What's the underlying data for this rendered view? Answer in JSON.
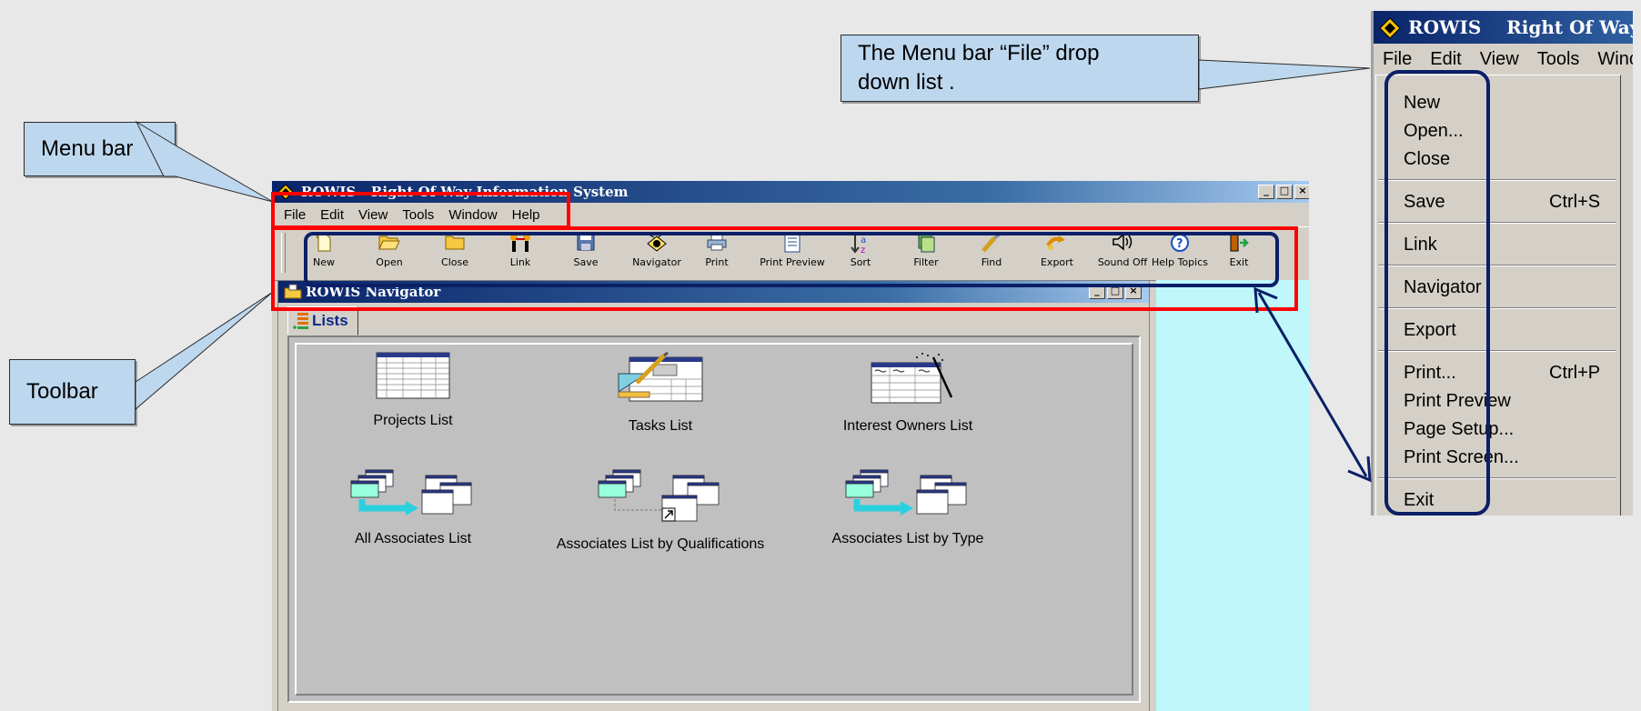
{
  "callouts": {
    "menu_bar": "Menu bar",
    "toolbar": "Toolbar",
    "file_dropdown": "The Menu bar “File” drop down list ."
  },
  "app": {
    "title": "ROWIS - Right Of Way Information System",
    "menu": [
      "File",
      "Edit",
      "View",
      "Tools",
      "Window",
      "Help"
    ],
    "window_buttons": [
      "_",
      "□",
      "×"
    ],
    "toolbar": [
      {
        "label": "New",
        "icon": "new-icon"
      },
      {
        "label": "Open",
        "icon": "open-folder-icon"
      },
      {
        "label": "Close",
        "icon": "close-folder-icon"
      },
      {
        "label": "Link",
        "icon": "link-icon"
      },
      {
        "label": "Save",
        "icon": "save-icon"
      },
      {
        "label": "Navigator",
        "icon": "navigator-icon"
      },
      {
        "label": "Print",
        "icon": "print-icon"
      },
      {
        "label": "Print Preview",
        "icon": "print-preview-icon"
      },
      {
        "label": "Sort",
        "icon": "sort-icon"
      },
      {
        "label": "Filter",
        "icon": "filter-icon"
      },
      {
        "label": "Find",
        "icon": "find-icon"
      },
      {
        "label": "Export",
        "icon": "export-icon"
      },
      {
        "label": "Sound Off",
        "icon": "sound-icon"
      },
      {
        "label": "Help Topics",
        "icon": "help-icon"
      },
      {
        "label": "Exit",
        "icon": "exit-icon"
      }
    ]
  },
  "navigator": {
    "title": "ROWIS Navigator",
    "tab": "Lists",
    "items": [
      {
        "label": "Projects List"
      },
      {
        "label": "Tasks List"
      },
      {
        "label": "Interest Owners List"
      },
      {
        "label": "All Associates List"
      },
      {
        "label": "Associates List by Qualifications"
      },
      {
        "label": "Associates List by Type"
      }
    ]
  },
  "dropdown": {
    "title": "ROWIS    Right Of Way Ir",
    "menu": [
      "File",
      "Edit",
      "View",
      "Tools",
      "Winc"
    ],
    "items": [
      {
        "label": "New",
        "shortcut": ""
      },
      {
        "label": "Open...",
        "shortcut": ""
      },
      {
        "label": "Close",
        "shortcut": ""
      },
      {
        "label": "Save",
        "shortcut": "Ctrl+S"
      },
      {
        "label": "Link",
        "shortcut": ""
      },
      {
        "label": "Navigator",
        "shortcut": ""
      },
      {
        "label": "Export",
        "shortcut": ""
      },
      {
        "label": "Print...",
        "shortcut": "Ctrl+P"
      },
      {
        "label": "Print Preview",
        "shortcut": ""
      },
      {
        "label": "Page Setup...",
        "shortcut": ""
      },
      {
        "label": "Print Screen...",
        "shortcut": ""
      },
      {
        "label": "Exit",
        "shortcut": ""
      }
    ]
  },
  "colors": {
    "callout_fill": "#bdd7ee",
    "highlight_red": "#ff0000",
    "highlight_navy": "#0b1f66",
    "title_gradient_start": "#0a246a"
  }
}
